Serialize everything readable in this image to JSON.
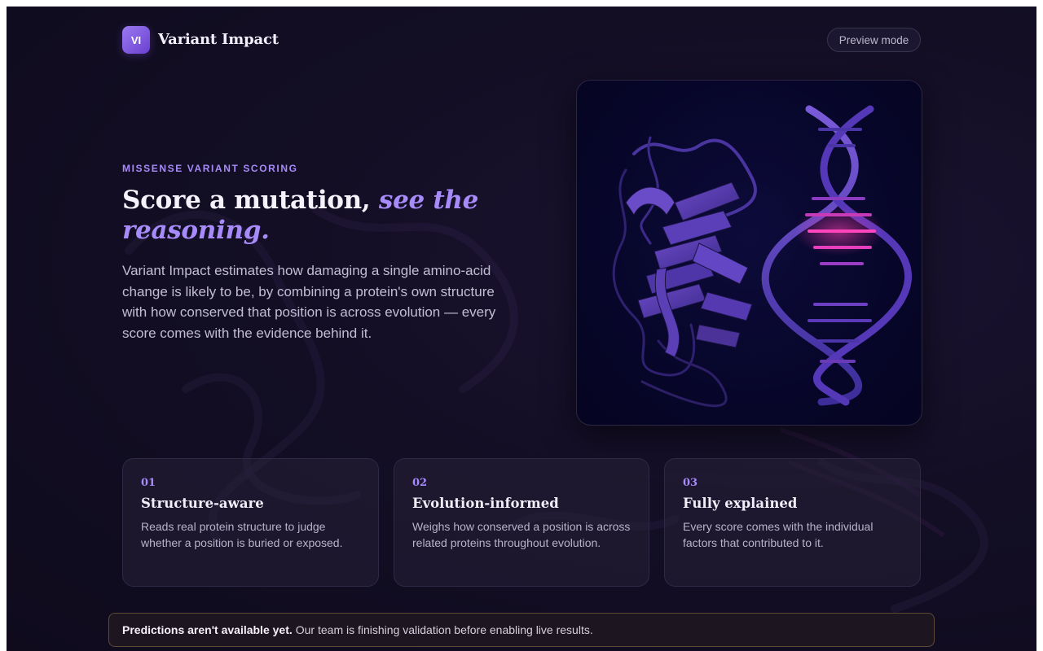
{
  "header": {
    "logo_initials": "VI",
    "app_name": "Variant Impact",
    "preview_label": "Preview mode"
  },
  "hero": {
    "eyebrow": "MISSENSE VARIANT SCORING",
    "headline_plain": "Score a mutation,",
    "headline_accent": "see the reasoning.",
    "lead": "Variant Impact estimates how damaging a single amino-acid change is likely to be, by combining a protein's own structure with how conserved that position is across evolution — every score comes with the evidence behind it.",
    "illustration": "protein-and-dna-illustration"
  },
  "features": [
    {
      "number": "01",
      "title": "Structure-aware",
      "description": "Reads real protein structure to judge whether a position is buried or exposed."
    },
    {
      "number": "02",
      "title": "Evolution-informed",
      "description": "Weighs how conserved a position is across related proteins throughout evolution."
    },
    {
      "number": "03",
      "title": "Fully explained",
      "description": "Every score comes with the individual factors that contributed to it."
    }
  ],
  "notice": {
    "bold": "Predictions aren't available yet.",
    "text": "Our team is finishing validation before enabling live results."
  },
  "colors": {
    "background": "#130e24",
    "accent": "#a78bfa",
    "notice_border": "#5e4a36"
  }
}
